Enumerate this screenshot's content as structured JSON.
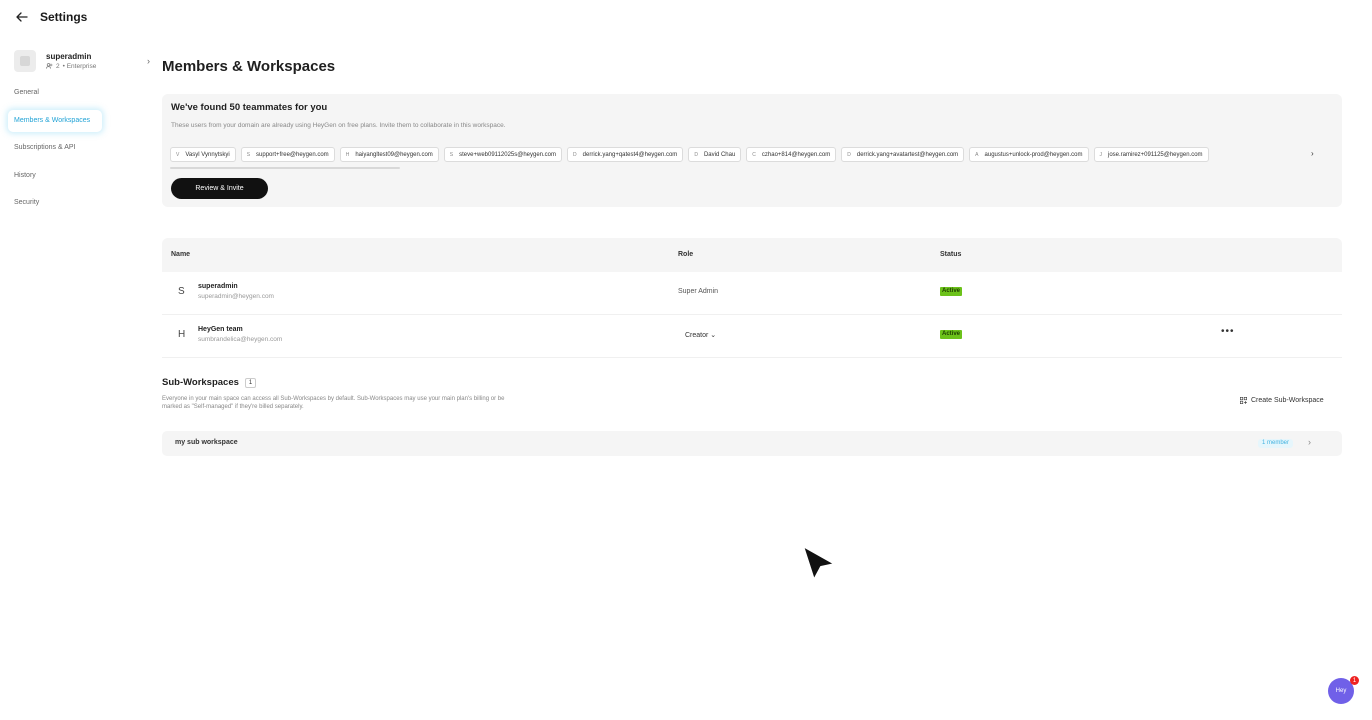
{
  "header": {
    "title": "Settings",
    "back_icon": "arrow-left-icon"
  },
  "sidebar": {
    "account": {
      "name": "superadmin",
      "member_count": "2",
      "plan": "• Enterprise"
    },
    "items": [
      {
        "label": "General",
        "active": false
      },
      {
        "label": "Members & Workspaces",
        "active": true
      },
      {
        "label": "Subscriptions & API",
        "active": false
      },
      {
        "label": "History",
        "active": false
      },
      {
        "label": "Security",
        "active": false
      }
    ]
  },
  "main": {
    "title": "Members & Workspaces",
    "invite": {
      "title": "We've found 50 teammates for you",
      "description": "These users from your domain are already using HeyGen on free plans. Invite them to collaborate in this workspace.",
      "button": "Review & Invite",
      "chips": [
        {
          "initial": "V",
          "label": "Vasyl Vynnytskyi"
        },
        {
          "initial": "S",
          "label": "support+free@heygen.com"
        },
        {
          "initial": "H",
          "label": "haiyangltest09@heygen.com"
        },
        {
          "initial": "S",
          "label": "steve+web09112025s@heygen.com"
        },
        {
          "initial": "D",
          "label": "derrick.yang+qatest4@heygen.com"
        },
        {
          "initial": "D",
          "label": "David Chau"
        },
        {
          "initial": "C",
          "label": "czhao+814@heygen.com"
        },
        {
          "initial": "D",
          "label": "derrick.yang+avatartest@heygen.com"
        },
        {
          "initial": "A",
          "label": "augustus+unlock-prod@heygen.com"
        },
        {
          "initial": "J",
          "label": "jose.ramirez+091125@heygen.com"
        }
      ]
    },
    "members_table": {
      "columns": [
        "Name",
        "Role",
        "Status"
      ],
      "rows": [
        {
          "initial": "S",
          "name": "superadmin",
          "email": "superadmin@heygen.com",
          "role": "Super Admin",
          "status": "Active"
        },
        {
          "initial": "H",
          "name": "HeyGen team",
          "email": "sumbrandelica@heygen.com",
          "role": "Creator ⌄",
          "status": "Active",
          "more": "•••"
        }
      ]
    },
    "sub_workspaces": {
      "title": "Sub-Workspaces",
      "count": "1",
      "description": "Everyone in your main space can access all Sub-Workspaces by default. Sub-Workspaces may use your main plan's billing or be marked as \"Self-managed\" if they're billed separately.",
      "create_label": "Create Sub-Workspace",
      "items": [
        {
          "name": "my sub workspace",
          "members": "1 member"
        }
      ]
    }
  },
  "help": {
    "label": "Hey",
    "badge": "1"
  },
  "colors": {
    "accent": "#22a3d6",
    "status_active": "#6cc21a",
    "help_bubble": "#7060e8"
  }
}
